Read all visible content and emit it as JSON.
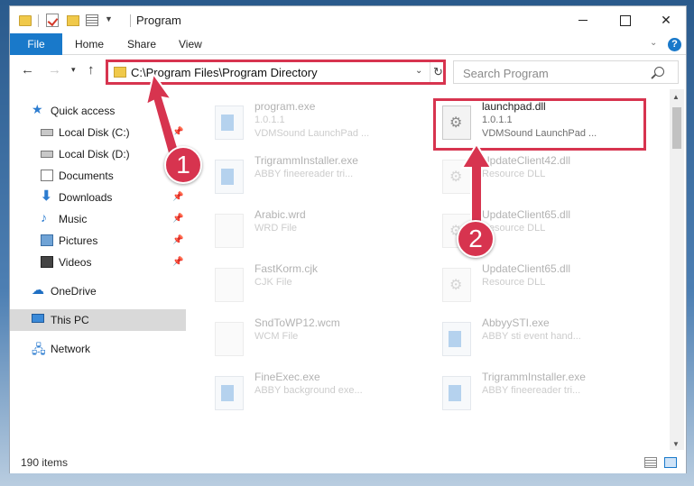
{
  "window": {
    "title": "Program",
    "minimize_label": "",
    "maximize_label": "",
    "close_label": "✕"
  },
  "ribbon": {
    "file": "File",
    "home": "Home",
    "share": "Share",
    "view": "View",
    "help": "?"
  },
  "nav": {
    "back": "←",
    "forward": "→",
    "recent": "▾",
    "up": "↑",
    "address": "C:\\Program Files\\Program Directory",
    "address_dropdown": "⌄",
    "refresh": "↻",
    "search_placeholder": "Search Program"
  },
  "sidebar": {
    "items": [
      {
        "label": "Quick access",
        "icon": "star-icon",
        "pinned": false
      },
      {
        "label": "Local Disk (C:)",
        "icon": "disk-icon",
        "pinned": true
      },
      {
        "label": "Local Disk (D:)",
        "icon": "disk-icon",
        "pinned": false
      },
      {
        "label": "Documents",
        "icon": "documents-icon",
        "pinned": false
      },
      {
        "label": "Downloads",
        "icon": "download-icon",
        "pinned": true
      },
      {
        "label": "Music",
        "icon": "music-icon",
        "pinned": true
      },
      {
        "label": "Pictures",
        "icon": "pictures-icon",
        "pinned": true
      },
      {
        "label": "Videos",
        "icon": "videos-icon",
        "pinned": true
      },
      {
        "label": "OneDrive",
        "icon": "cloud-icon",
        "pinned": false
      },
      {
        "label": "This PC",
        "icon": "pc-icon",
        "pinned": false,
        "selected": true
      },
      {
        "label": "Network",
        "icon": "network-icon",
        "pinned": false
      }
    ]
  },
  "files": [
    {
      "name": "program.exe",
      "line1": "1.0.1.1",
      "line2": "VDMSound LaunchPad ...",
      "type": "exe"
    },
    {
      "name": "launchpad.dll",
      "line1": "1.0.1.1",
      "line2": "VDMSound LaunchPad ...",
      "type": "dll",
      "highlighted": true
    },
    {
      "name": "TrigrammInstaller.exe",
      "line1": "ABBY fineereader tri...",
      "line2": "",
      "type": "exe"
    },
    {
      "name": "UpdateClient42.dll",
      "line1": "Resource DLL",
      "line2": "",
      "type": "dll"
    },
    {
      "name": "Arabic.wrd",
      "line1": "WRD File",
      "line2": "",
      "type": "file"
    },
    {
      "name": "UpdateClient65.dll",
      "line1": "Resource DLL",
      "line2": "",
      "type": "dll"
    },
    {
      "name": "FastKorm.cjk",
      "line1": "CJK File",
      "line2": "",
      "type": "file"
    },
    {
      "name": "UpdateClient65.dll",
      "line1": "Resource DLL",
      "line2": "",
      "type": "dll"
    },
    {
      "name": "SndToWP12.wcm",
      "line1": "WCM File",
      "line2": "",
      "type": "file"
    },
    {
      "name": "AbbyySTI.exe",
      "line1": "ABBY sti event hand...",
      "line2": "",
      "type": "exe"
    },
    {
      "name": "FineExec.exe",
      "line1": "ABBY background exe...",
      "line2": "",
      "type": "exe"
    },
    {
      "name": "TrigrammInstaller.exe",
      "line1": "ABBY fineereader tri...",
      "line2": "",
      "type": "exe"
    }
  ],
  "status": {
    "item_count": "190 items"
  },
  "annotations": {
    "step1": "1",
    "step2": "2",
    "color": "#d7344f"
  },
  "colors": {
    "accent": "#1979ca",
    "highlight": "#d7344f"
  }
}
